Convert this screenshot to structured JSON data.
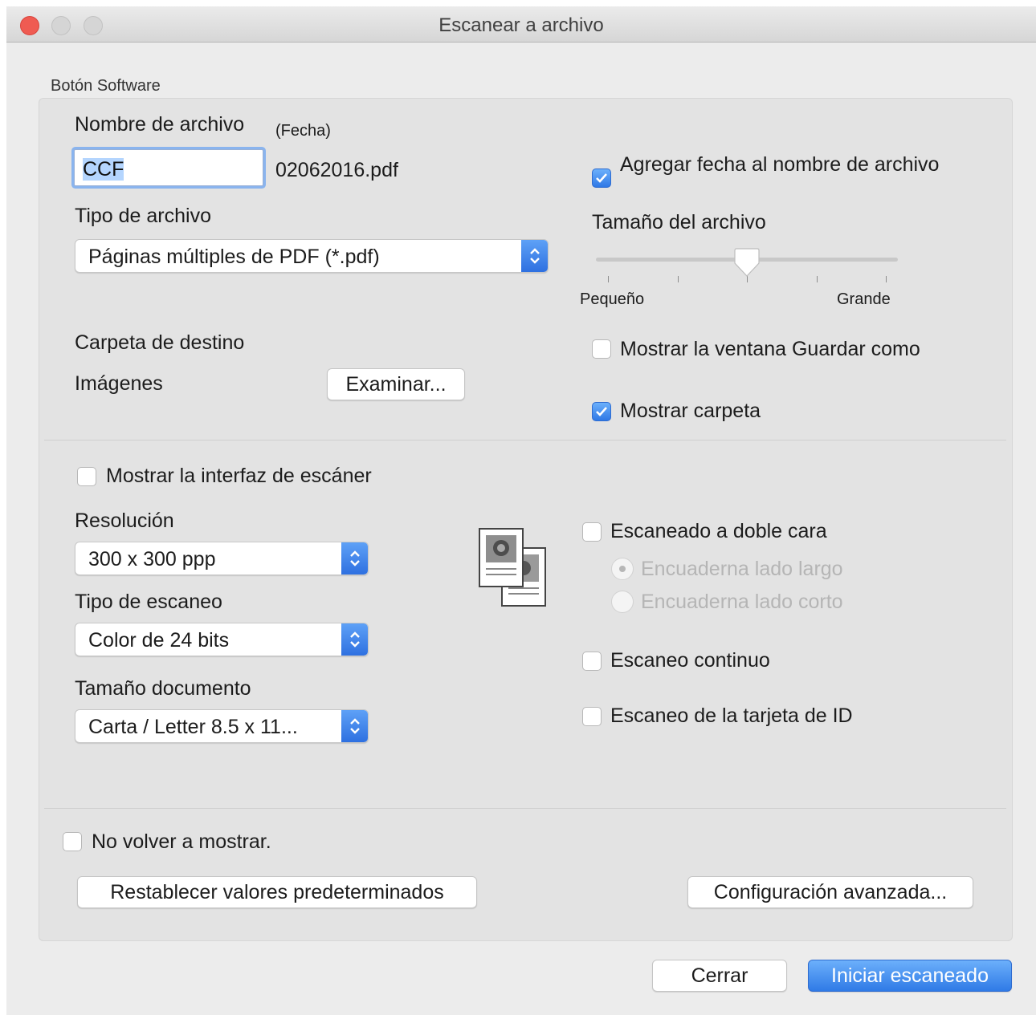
{
  "window": {
    "title": "Escanear a archivo"
  },
  "group": {
    "label": "Botón Software"
  },
  "filename": {
    "label": "Nombre de archivo",
    "date_label": "(Fecha)",
    "value": "CCF",
    "suffix": "02062016.pdf"
  },
  "add_date": {
    "label": "Agregar fecha al nombre de archivo",
    "checked": true
  },
  "file_type": {
    "label": "Tipo de archivo",
    "selected": "Páginas múltiples de PDF (*.pdf)"
  },
  "file_size": {
    "label": "Tamaño del archivo",
    "min_label": "Pequeño",
    "max_label": "Grande",
    "level": 0.5
  },
  "destination": {
    "label": "Carpeta de destino",
    "value": "Imágenes",
    "browse_label": "Examinar..."
  },
  "show_save_as": {
    "label": "Mostrar la ventana Guardar como",
    "checked": false
  },
  "show_folder": {
    "label": "Mostrar carpeta",
    "checked": true
  },
  "show_scanner_ui": {
    "label": "Mostrar la interfaz de escáner",
    "checked": false
  },
  "resolution": {
    "label": "Resolución",
    "selected": "300 x 300 ppp"
  },
  "scan_type": {
    "label": "Tipo de escaneo",
    "selected": "Color de 24 bits"
  },
  "document_size": {
    "label": "Tamaño documento",
    "selected": "Carta / Letter 8.5 x 11..."
  },
  "duplex": {
    "label": "Escaneado a doble cara",
    "checked": false,
    "long_edge_label": "Encuaderna lado largo",
    "short_edge_label": "Encuaderna lado corto"
  },
  "continuous": {
    "label": "Escaneo continuo",
    "checked": false
  },
  "id_card": {
    "label": "Escaneo de la tarjeta de ID",
    "checked": false
  },
  "dont_show": {
    "label": "No volver a mostrar.",
    "checked": false
  },
  "buttons": {
    "reset": "Restablecer valores predeterminados",
    "advanced": "Configuración avanzada...",
    "close": "Cerrar",
    "start": "Iniciar escaneado"
  },
  "colors": {
    "accent": "#2f78e6",
    "close_light": "#ef5b52"
  },
  "icons": {
    "duplex": "duplex-pages-icon"
  }
}
